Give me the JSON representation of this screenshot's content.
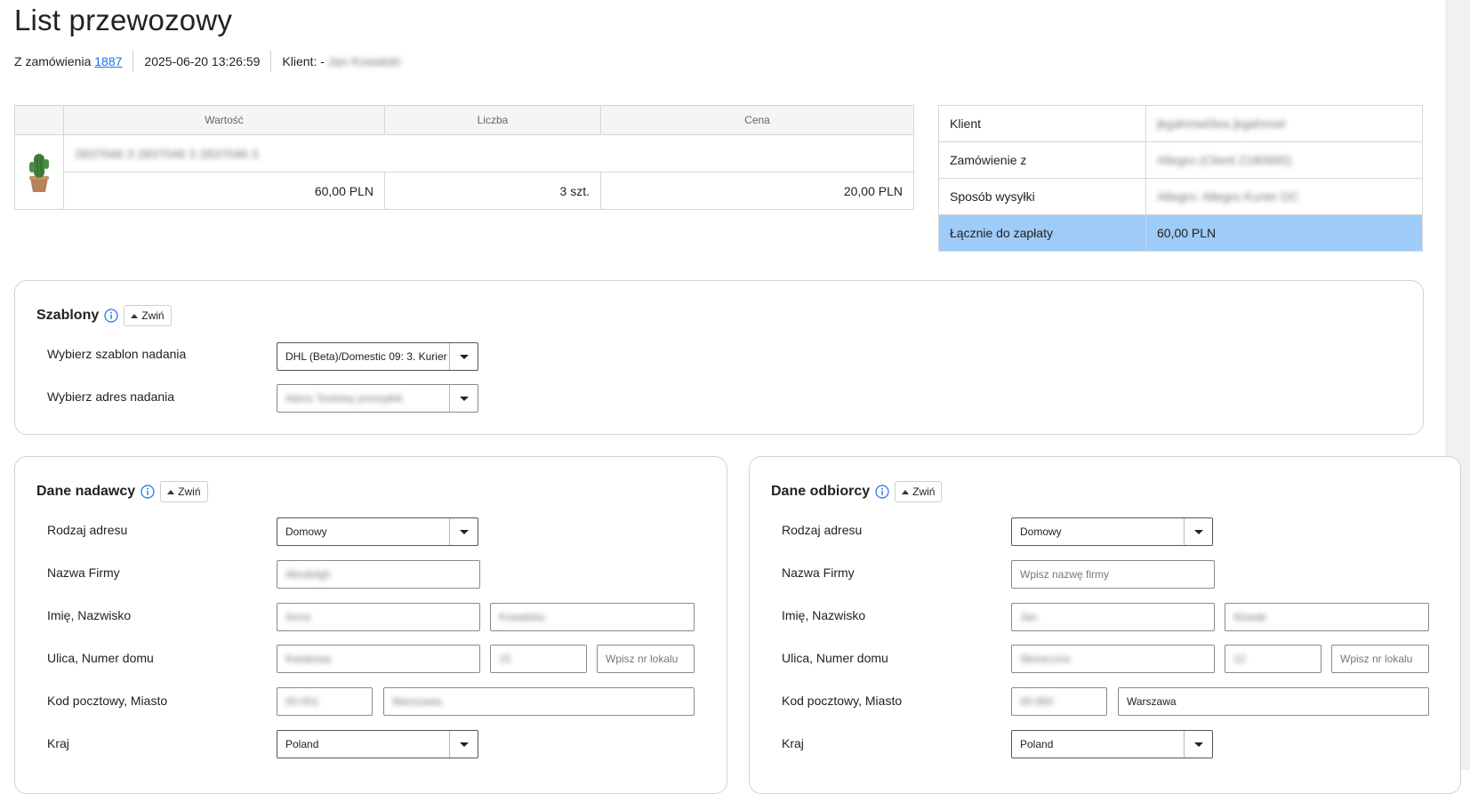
{
  "page": {
    "title": "List przewozowy"
  },
  "meta": {
    "from_order_label": "Z zamówienia",
    "order_number": "1887",
    "datetime": "2025-06-20 13:26:59",
    "client_label": "Klient: -",
    "client_value": "Jan Kowalski"
  },
  "products": {
    "headers": [
      "Wartość",
      "Liczba",
      "Cena"
    ],
    "item": {
      "name": "2837046 3 2837046 3 2837046 3",
      "value": "60,00 PLN",
      "quantity": "3 szt.",
      "price": "20,00 PLN"
    }
  },
  "summary": {
    "rows": [
      {
        "label": "Klient",
        "value": "jkgahmwl3ea jkgahmwl"
      },
      {
        "label": "Zamówienie z",
        "value": "Allegro (Client 2180685)"
      },
      {
        "label": "Sposób wysyłki",
        "value": "Allegro: Allegro Kurier DC"
      }
    ],
    "total_label": "Łącznie do zapłaty",
    "total_value": "60,00 PLN",
    "total_bg": "#9ecbf7"
  },
  "templates": {
    "title": "Szablony",
    "collapse_label": "Zwiń",
    "template_label": "Wybierz szablon nadania",
    "template_value": "DHL (Beta)/Domestic 09: 3. Kurier",
    "address_label": "Wybierz adres nadania",
    "address_value": "Adres Testowy przesyłek"
  },
  "sender": {
    "title": "Dane nadawcy",
    "collapse_label": "Zwiń",
    "address_type_label": "Rodzaj adresu",
    "address_type_value": "Domowy",
    "company_label": "Nazwa Firmy",
    "company_value": "Abcdefgh",
    "name_label": "Imię, Nazwisko",
    "first_name": "Anna",
    "last_name": "Kowalska",
    "street_label": "Ulica, Numer domu",
    "street": "Kwiatowa",
    "house_no": "15",
    "flat_placeholder": "Wpisz nr lokalu",
    "postal_label": "Kod pocztowy, Miasto",
    "postal": "00-001",
    "city": "Warszawa",
    "country_label": "Kraj",
    "country": "Poland"
  },
  "recipient": {
    "title": "Dane odbiorcy",
    "collapse_label": "Zwiń",
    "address_type_label": "Rodzaj adresu",
    "address_type_value": "Domowy",
    "company_label": "Nazwa Firmy",
    "company_placeholder": "Wpisz nazwę firmy",
    "name_label": "Imię, Nazwisko",
    "first_name": "Jan",
    "last_name": "Nowak",
    "street_label": "Ulica, Numer domu",
    "street": "Słoneczna",
    "house_no": "12",
    "flat_placeholder": "Wpisz nr lokalu",
    "postal_label": "Kod pocztowy, Miasto",
    "postal": "00-950",
    "city": "Warszawa",
    "country_label": "Kraj",
    "country": "Poland"
  },
  "icons": {
    "info": "info-icon",
    "collapse": "caret-up-icon",
    "dropdown": "caret-down-icon",
    "product": "cactus-image"
  },
  "colors": {
    "link": "#1a73e8",
    "info_icon": "#1a73e8"
  }
}
